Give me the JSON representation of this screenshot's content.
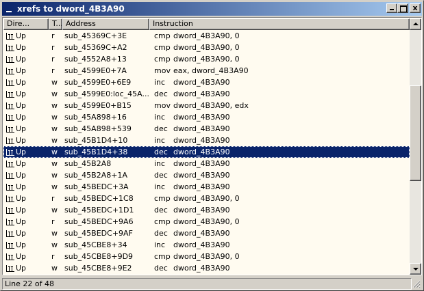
{
  "window": {
    "title": "xrefs to dword_4B3A90",
    "close_glyph": "x"
  },
  "columns": {
    "direction": "Dire...",
    "type": "T...",
    "address": "Address",
    "instruction": "Instruction"
  },
  "rows": [
    {
      "dir": "Up",
      "type": "r",
      "address": "sub_45369C+3E",
      "op": "cmp",
      "args": "dword_4B3A90, 0"
    },
    {
      "dir": "Up",
      "type": "r",
      "address": "sub_45369C+A2",
      "op": "cmp",
      "args": "dword_4B3A90, 0"
    },
    {
      "dir": "Up",
      "type": "r",
      "address": "sub_4552A8+13",
      "op": "cmp",
      "args": "dword_4B3A90, 0"
    },
    {
      "dir": "Up",
      "type": "r",
      "address": "sub_4599E0+7A",
      "op": "mov",
      "args": "eax, dword_4B3A90"
    },
    {
      "dir": "Up",
      "type": "w",
      "address": "sub_4599E0+6E9",
      "op": "inc",
      "args": "dword_4B3A90"
    },
    {
      "dir": "Up",
      "type": "w",
      "address": "sub_4599E0:loc_45A...",
      "op": "dec",
      "args": "dword_4B3A90"
    },
    {
      "dir": "Up",
      "type": "w",
      "address": "sub_4599E0+B15",
      "op": "mov",
      "args": "dword_4B3A90, edx"
    },
    {
      "dir": "Up",
      "type": "w",
      "address": "sub_45A898+16",
      "op": "inc",
      "args": "dword_4B3A90"
    },
    {
      "dir": "Up",
      "type": "w",
      "address": "sub_45A898+539",
      "op": "dec",
      "args": "dword_4B3A90"
    },
    {
      "dir": "Up",
      "type": "w",
      "address": "sub_45B1D4+10",
      "op": "inc",
      "args": "dword_4B3A90"
    },
    {
      "dir": "Up",
      "type": "w",
      "address": "sub_45B1D4+38",
      "op": "dec",
      "args": "dword_4B3A90",
      "selected": true
    },
    {
      "dir": "Up",
      "type": "w",
      "address": "sub_45B2A8",
      "op": "inc",
      "args": "dword_4B3A90"
    },
    {
      "dir": "Up",
      "type": "w",
      "address": "sub_45B2A8+1A",
      "op": "dec",
      "args": "dword_4B3A90"
    },
    {
      "dir": "Up",
      "type": "w",
      "address": "sub_45BEDC+3A",
      "op": "inc",
      "args": "dword_4B3A90"
    },
    {
      "dir": "Up",
      "type": "r",
      "address": "sub_45BEDC+1C8",
      "op": "cmp",
      "args": "dword_4B3A90, 0"
    },
    {
      "dir": "Up",
      "type": "w",
      "address": "sub_45BEDC+1D1",
      "op": "dec",
      "args": "dword_4B3A90"
    },
    {
      "dir": "Up",
      "type": "r",
      "address": "sub_45BEDC+9A6",
      "op": "cmp",
      "args": "dword_4B3A90, 0"
    },
    {
      "dir": "Up",
      "type": "w",
      "address": "sub_45BEDC+9AF",
      "op": "dec",
      "args": "dword_4B3A90"
    },
    {
      "dir": "Up",
      "type": "w",
      "address": "sub_45CBE8+34",
      "op": "inc",
      "args": "dword_4B3A90"
    },
    {
      "dir": "Up",
      "type": "r",
      "address": "sub_45CBE8+9D9",
      "op": "cmp",
      "args": "dword_4B3A90, 0"
    },
    {
      "dir": "Up",
      "type": "w",
      "address": "sub_45CBE8+9E2",
      "op": "dec",
      "args": "dword_4B3A90"
    }
  ],
  "status": {
    "text": "Line 22 of 48"
  },
  "colors": {
    "list_background": "#fffbf0",
    "selection": "#0a246a",
    "title_gradient_start": "#0a246a",
    "title_gradient_end": "#a6caf0"
  },
  "icons": {
    "title": "window-icon",
    "direction": "xref-direction-icon",
    "scroll_up": "arrow-up-icon",
    "scroll_down": "arrow-down-icon"
  }
}
